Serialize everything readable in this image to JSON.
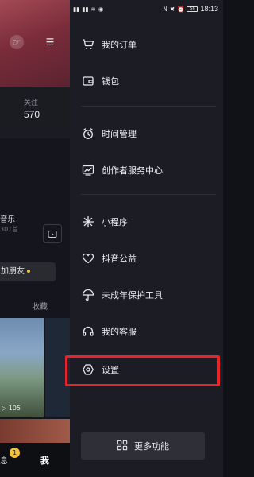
{
  "background_page": {
    "follow_label": "关注",
    "follow_count": "570",
    "music_label": "音乐",
    "music_count": "301首",
    "add_friend_label": "加朋友",
    "collect_label": "收藏",
    "photo_count": "105",
    "tab_messages": "息",
    "tab_messages_badge": "1",
    "tab_me": "我"
  },
  "status_bar": {
    "time": "18:13",
    "battery": "56"
  },
  "drawer": {
    "group1": [
      {
        "label": "我的订单",
        "icon": "cart-icon"
      },
      {
        "label": "钱包",
        "icon": "wallet-icon"
      }
    ],
    "group2": [
      {
        "label": "时间管理",
        "icon": "alarm-clock-icon"
      },
      {
        "label": "创作者服务中心",
        "icon": "creator-chart-icon"
      }
    ],
    "group3": [
      {
        "label": "小程序",
        "icon": "mini-program-icon"
      },
      {
        "label": "抖音公益",
        "icon": "charity-heart-icon"
      },
      {
        "label": "未成年保护工具",
        "icon": "umbrella-icon"
      },
      {
        "label": "我的客服",
        "icon": "headset-icon"
      },
      {
        "label": "设置",
        "icon": "settings-hexagon-icon"
      }
    ],
    "more_button": {
      "label": "更多功能",
      "icon": "grid-apps-icon"
    }
  },
  "colors": {
    "drawer_bg": "#1b1c24",
    "highlight_border": "#e6242b",
    "accent_yellow": "#f2c33a"
  }
}
